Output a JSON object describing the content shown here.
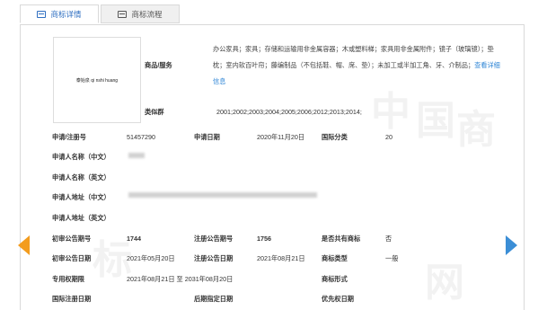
{
  "tabs": {
    "detail": "商标详情",
    "flow": "商标流程"
  },
  "image_text": "泰始泉 qi nshi huang",
  "goods": {
    "label": "商品/服务",
    "text": "办公家具；家具；存储和运输用非金属容器；木或塑料梯；家具用非金属附件；镜子（玻璃镜）；垫枕；室内软百叶帘；藤编制品（不包括鞋、帽、席、垫）；未加工或半加工角、牙、介制品；",
    "link": "查看详细信息"
  },
  "classes": {
    "label": "类似群",
    "value": "2001;2002;2003;2004;2005;2006;2012;2013;2014;"
  },
  "fields": {
    "reg_no_label": "申请/注册号",
    "reg_no": "51457290",
    "app_date_label": "申请日期",
    "app_date": "2020年11月20日",
    "intl_class_label": "国际分类",
    "intl_class": "20",
    "name_cn_label": "申请人名称（中文）",
    "name_en_label": "申请人名称（英文）",
    "addr_cn_label": "申请人地址（中文）",
    "addr_en_label": "申请人地址（英文）",
    "prelim_no_label": "初审公告期号",
    "prelim_no": "1744",
    "reg_pub_no_label": "注册公告期号",
    "reg_pub_no": "1756",
    "shared_label": "是否共有商标",
    "shared": "否",
    "prelim_date_label": "初审公告日期",
    "prelim_date": "2021年05月20日",
    "reg_pub_date_label": "注册公告日期",
    "reg_pub_date": "2021年08月21日",
    "type_label": "商标类型",
    "type": "一般",
    "excl_label": "专用权期限",
    "excl": "2021年08月21日 至 2031年08月20日",
    "form_label": "商标形式",
    "intl_reg_label": "国际注册日期",
    "later_label": "后期指定日期",
    "priority_label": "优先权日期"
  },
  "colors": {
    "accent": "#2f6fc1",
    "link": "#2f86d6",
    "prev": "#f39c1e",
    "next": "#3b8ed6"
  },
  "watermark": [
    "中",
    "国",
    "商",
    "标",
    "网"
  ]
}
